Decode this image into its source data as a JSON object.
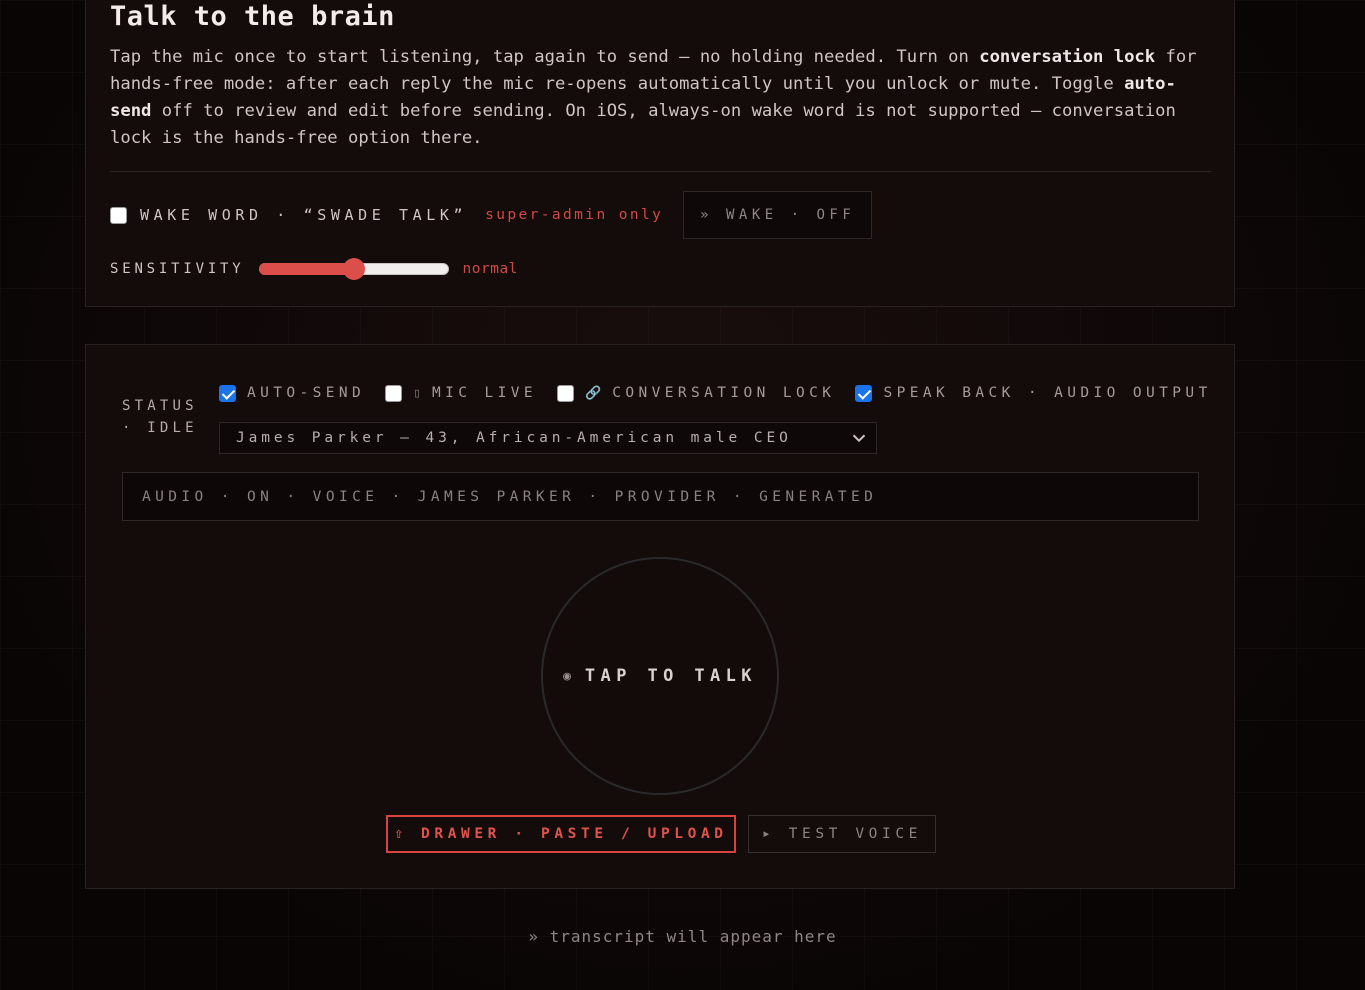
{
  "intro": {
    "title": "Talk to the brain",
    "desc_1": "Tap the mic once to start listening, tap again to send — no holding needed. Turn on ",
    "desc_bold_1": "conversation lock",
    "desc_2": " for hands-free mode: after each reply the mic re-opens automatically until you unlock or mute. Toggle ",
    "desc_bold_2": "auto-send",
    "desc_3": " off to review and edit before sending. On iOS, always-on wake word is not supported — conversation lock is the hands-free option there."
  },
  "wake": {
    "checked": false,
    "label": "WAKE WORD · “SWADE TALK”",
    "note": "super-admin only",
    "button": "» WAKE · OFF"
  },
  "sensitivity": {
    "label": "SENSITIVITY",
    "value_pct": 50,
    "value_label": "normal"
  },
  "status": {
    "line1": "STATUS",
    "line2": "· IDLE"
  },
  "options": {
    "auto_send": {
      "label": "AUTO-SEND",
      "checked": true
    },
    "mic_live": {
      "glyph": "▯",
      "label": "MIC LIVE",
      "checked": false
    },
    "conversation_lock": {
      "glyph": "🔗",
      "label": "CONVERSATION LOCK",
      "checked": false
    },
    "speak_back": {
      "label": "SPEAK BACK · AUDIO OUTPUT",
      "checked": true
    }
  },
  "voice_select": {
    "selected": "James Parker — 43, African-American male CEO"
  },
  "audio_status": "AUDIO · ON · VOICE · JAMES PARKER · PROVIDER · GENERATED",
  "mic": {
    "dot": "◉",
    "label": "TAP TO TALK"
  },
  "actions": {
    "drawer": "⇧ DRAWER · PASTE / UPLOAD",
    "test_voice": "▸ TEST VOICE"
  },
  "transcript_placeholder": "» transcript will appear here",
  "colors": {
    "accent": "#db4e49",
    "checkbox_on": "#1a73e8",
    "background": "#0e0808",
    "panel": "#140b0b"
  }
}
